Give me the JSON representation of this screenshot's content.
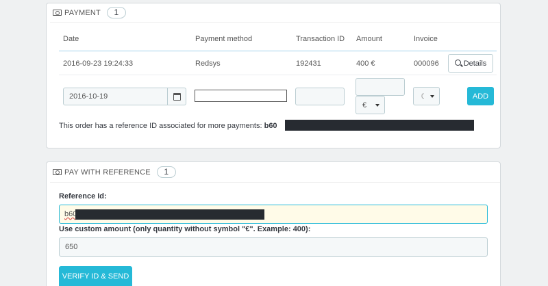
{
  "payment": {
    "title": "Payment",
    "count": "1",
    "columns": [
      "Date",
      "Payment method",
      "Transaction ID",
      "Amount",
      "Invoice"
    ],
    "row": {
      "date": "2016-09-23 19:24:33",
      "method": "Redsys",
      "transaction_id": "192431",
      "amount": "400 €",
      "invoice": "000096",
      "details_label": "Details"
    },
    "form": {
      "date_value": "2016-10-19",
      "currency_value": "€",
      "invoice_value": "0",
      "add_label": "ADD"
    },
    "reference_note": "This order has a reference ID associated for more payments:",
    "reference_prefix": "b60"
  },
  "pay_with_reference": {
    "title": "Pay with reference",
    "count": "1",
    "reference_label": "Reference Id:",
    "reference_value_prefix": "b60",
    "custom_amount_label": "Use custom amount (only quantity without symbol \"€\". Example: 400):",
    "custom_amount_value": "650",
    "submit_label": "VERIFY ID & SEND"
  },
  "colors": {
    "accent": "#25b9d7",
    "redaction": "#272b31",
    "highlight_input": "#fffbe8"
  }
}
